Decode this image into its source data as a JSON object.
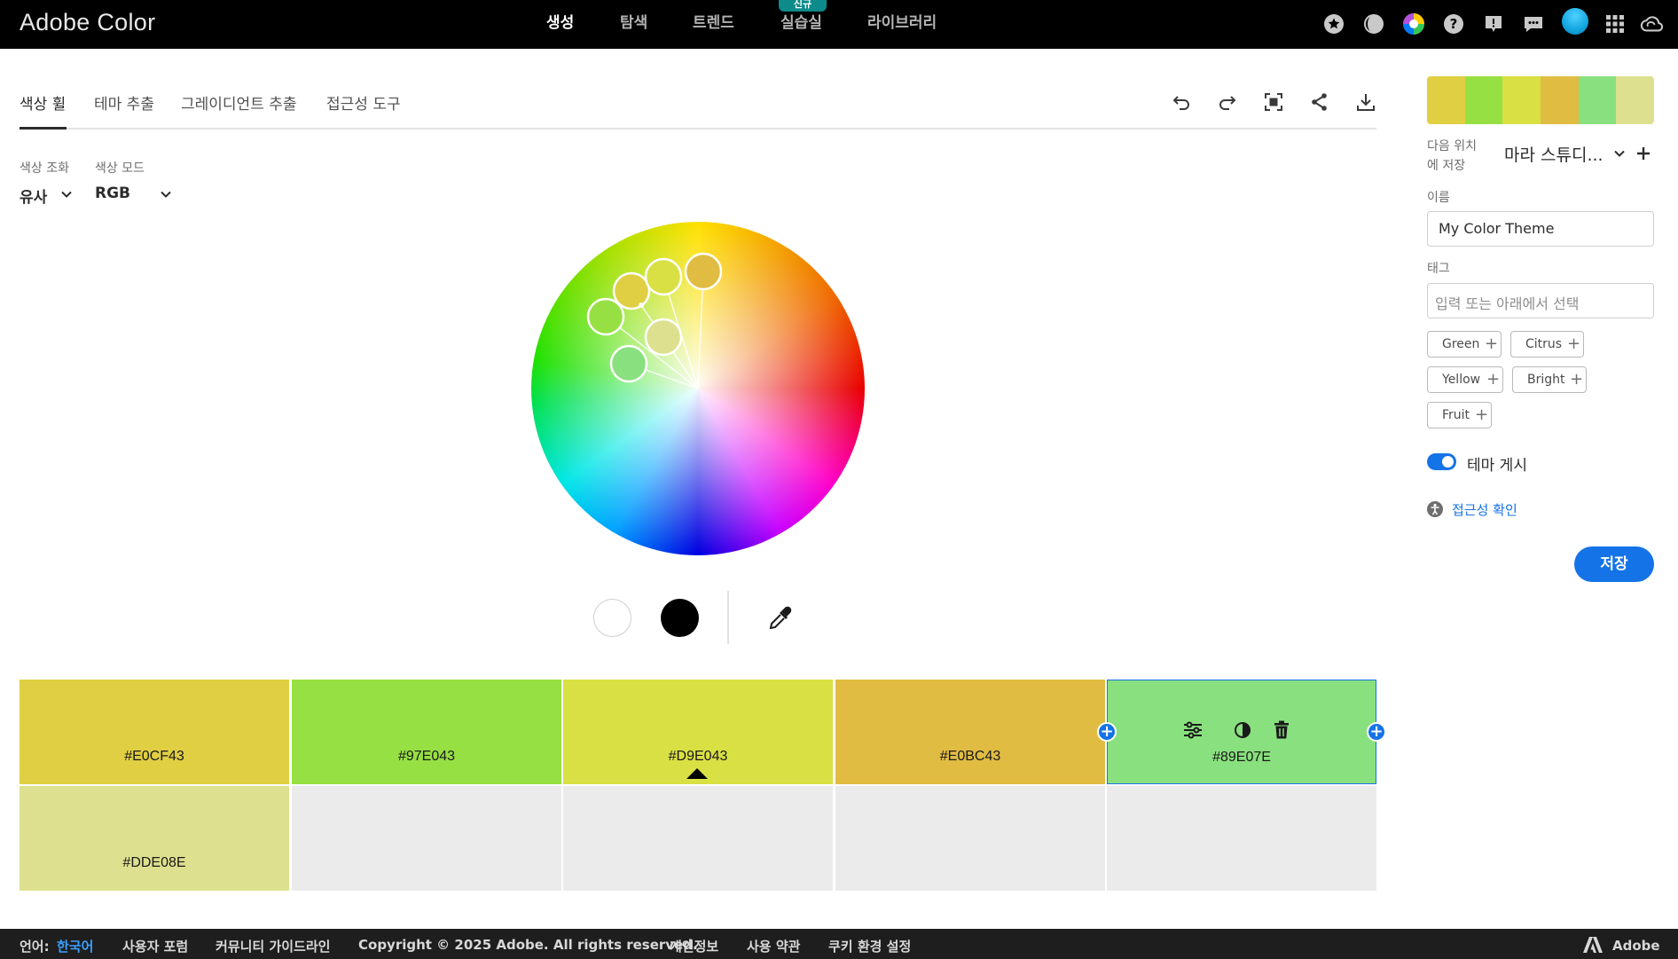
{
  "app": {
    "brand": "Adobe Color"
  },
  "nav": {
    "items": [
      {
        "label": "생성",
        "active": true
      },
      {
        "label": "탐색",
        "active": false
      },
      {
        "label": "트렌드",
        "active": false
      },
      {
        "label": "실습실",
        "active": false,
        "badge": "신규"
      },
      {
        "label": "라이브러리",
        "active": false
      }
    ],
    "icons": [
      "star-icon",
      "contrast-icon",
      "color-wheel-icon",
      "help-icon",
      "feedback-icon",
      "chat-icon",
      "avatar",
      "apps-grid-icon",
      "creative-cloud-icon"
    ]
  },
  "tabs": [
    {
      "label": "색상 휠",
      "active": true
    },
    {
      "label": "테마 추출",
      "active": false
    },
    {
      "label": "그레이디언트 추출",
      "active": false
    },
    {
      "label": "접근성 도구",
      "active": false
    }
  ],
  "toolbar": [
    "undo-icon",
    "redo-icon",
    "fit-screen-icon",
    "share-icon",
    "download-icon"
  ],
  "harmony": {
    "label": "색상 조화",
    "value": "유사"
  },
  "mode": {
    "label": "색상 모드",
    "value": "RGB"
  },
  "wheel": {
    "markers": [
      {
        "color": "#E0CF43"
      },
      {
        "color": "#97E043"
      },
      {
        "color": "#D9E043"
      },
      {
        "color": "#E0BC43"
      },
      {
        "color": "#89E07E"
      },
      {
        "color": "#DDE08E"
      }
    ]
  },
  "swatches": [
    {
      "hex": "#E0CF43",
      "color": "#E0CF43"
    },
    {
      "hex": "#97E043",
      "color": "#97E043"
    },
    {
      "hex": "#D9E043",
      "color": "#D9E043"
    },
    {
      "hex": "#E0BC43",
      "color": "#E0BC43"
    },
    {
      "hex": "#89E07E",
      "color": "#89E07E",
      "selected": true
    },
    {
      "hex": "#DDE08E",
      "color": "#DDE08E"
    }
  ],
  "panel": {
    "save_to_label_1": "다음 위치",
    "save_to_label_2": "에 저장",
    "library": "마라 스튜디...",
    "name_label": "이름",
    "name_value": "My Color Theme",
    "tags_label": "태그",
    "tags_placeholder": "입력 또는 아래에서 선택",
    "tags": [
      "Green",
      "Citrus",
      "Yellow",
      "Bright",
      "Fruit"
    ],
    "publish_label": "테마 게시",
    "publish_on": true,
    "accessibility_link": "접근성 확인",
    "save_button": "저장"
  },
  "footer": {
    "lang_label": "언어:",
    "lang_value": "한국어",
    "links": [
      "사용자 포럼",
      "커뮤니티 가이드라인",
      "Copyright © 2025 Adobe. All rights reserved.",
      "개인정보",
      "사용 약관",
      "쿠키 환경 설정"
    ],
    "adobe": "Adobe"
  },
  "colors": {
    "accent": "#1473E6",
    "topbar": "#000000",
    "badge": "#0D8B8B"
  }
}
